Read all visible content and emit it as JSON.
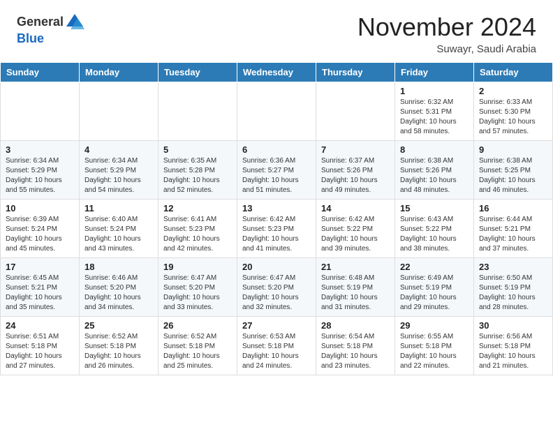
{
  "header": {
    "logo_line1": "General",
    "logo_line2": "Blue",
    "month_year": "November 2024",
    "location": "Suwayr, Saudi Arabia"
  },
  "weekdays": [
    "Sunday",
    "Monday",
    "Tuesday",
    "Wednesday",
    "Thursday",
    "Friday",
    "Saturday"
  ],
  "weeks": [
    [
      {
        "day": "",
        "info": ""
      },
      {
        "day": "",
        "info": ""
      },
      {
        "day": "",
        "info": ""
      },
      {
        "day": "",
        "info": ""
      },
      {
        "day": "",
        "info": ""
      },
      {
        "day": "1",
        "info": "Sunrise: 6:32 AM\nSunset: 5:31 PM\nDaylight: 10 hours\nand 58 minutes."
      },
      {
        "day": "2",
        "info": "Sunrise: 6:33 AM\nSunset: 5:30 PM\nDaylight: 10 hours\nand 57 minutes."
      }
    ],
    [
      {
        "day": "3",
        "info": "Sunrise: 6:34 AM\nSunset: 5:29 PM\nDaylight: 10 hours\nand 55 minutes."
      },
      {
        "day": "4",
        "info": "Sunrise: 6:34 AM\nSunset: 5:29 PM\nDaylight: 10 hours\nand 54 minutes."
      },
      {
        "day": "5",
        "info": "Sunrise: 6:35 AM\nSunset: 5:28 PM\nDaylight: 10 hours\nand 52 minutes."
      },
      {
        "day": "6",
        "info": "Sunrise: 6:36 AM\nSunset: 5:27 PM\nDaylight: 10 hours\nand 51 minutes."
      },
      {
        "day": "7",
        "info": "Sunrise: 6:37 AM\nSunset: 5:26 PM\nDaylight: 10 hours\nand 49 minutes."
      },
      {
        "day": "8",
        "info": "Sunrise: 6:38 AM\nSunset: 5:26 PM\nDaylight: 10 hours\nand 48 minutes."
      },
      {
        "day": "9",
        "info": "Sunrise: 6:38 AM\nSunset: 5:25 PM\nDaylight: 10 hours\nand 46 minutes."
      }
    ],
    [
      {
        "day": "10",
        "info": "Sunrise: 6:39 AM\nSunset: 5:24 PM\nDaylight: 10 hours\nand 45 minutes."
      },
      {
        "day": "11",
        "info": "Sunrise: 6:40 AM\nSunset: 5:24 PM\nDaylight: 10 hours\nand 43 minutes."
      },
      {
        "day": "12",
        "info": "Sunrise: 6:41 AM\nSunset: 5:23 PM\nDaylight: 10 hours\nand 42 minutes."
      },
      {
        "day": "13",
        "info": "Sunrise: 6:42 AM\nSunset: 5:23 PM\nDaylight: 10 hours\nand 41 minutes."
      },
      {
        "day": "14",
        "info": "Sunrise: 6:42 AM\nSunset: 5:22 PM\nDaylight: 10 hours\nand 39 minutes."
      },
      {
        "day": "15",
        "info": "Sunrise: 6:43 AM\nSunset: 5:22 PM\nDaylight: 10 hours\nand 38 minutes."
      },
      {
        "day": "16",
        "info": "Sunrise: 6:44 AM\nSunset: 5:21 PM\nDaylight: 10 hours\nand 37 minutes."
      }
    ],
    [
      {
        "day": "17",
        "info": "Sunrise: 6:45 AM\nSunset: 5:21 PM\nDaylight: 10 hours\nand 35 minutes."
      },
      {
        "day": "18",
        "info": "Sunrise: 6:46 AM\nSunset: 5:20 PM\nDaylight: 10 hours\nand 34 minutes."
      },
      {
        "day": "19",
        "info": "Sunrise: 6:47 AM\nSunset: 5:20 PM\nDaylight: 10 hours\nand 33 minutes."
      },
      {
        "day": "20",
        "info": "Sunrise: 6:47 AM\nSunset: 5:20 PM\nDaylight: 10 hours\nand 32 minutes."
      },
      {
        "day": "21",
        "info": "Sunrise: 6:48 AM\nSunset: 5:19 PM\nDaylight: 10 hours\nand 31 minutes."
      },
      {
        "day": "22",
        "info": "Sunrise: 6:49 AM\nSunset: 5:19 PM\nDaylight: 10 hours\nand 29 minutes."
      },
      {
        "day": "23",
        "info": "Sunrise: 6:50 AM\nSunset: 5:19 PM\nDaylight: 10 hours\nand 28 minutes."
      }
    ],
    [
      {
        "day": "24",
        "info": "Sunrise: 6:51 AM\nSunset: 5:18 PM\nDaylight: 10 hours\nand 27 minutes."
      },
      {
        "day": "25",
        "info": "Sunrise: 6:52 AM\nSunset: 5:18 PM\nDaylight: 10 hours\nand 26 minutes."
      },
      {
        "day": "26",
        "info": "Sunrise: 6:52 AM\nSunset: 5:18 PM\nDaylight: 10 hours\nand 25 minutes."
      },
      {
        "day": "27",
        "info": "Sunrise: 6:53 AM\nSunset: 5:18 PM\nDaylight: 10 hours\nand 24 minutes."
      },
      {
        "day": "28",
        "info": "Sunrise: 6:54 AM\nSunset: 5:18 PM\nDaylight: 10 hours\nand 23 minutes."
      },
      {
        "day": "29",
        "info": "Sunrise: 6:55 AM\nSunset: 5:18 PM\nDaylight: 10 hours\nand 22 minutes."
      },
      {
        "day": "30",
        "info": "Sunrise: 6:56 AM\nSunset: 5:18 PM\nDaylight: 10 hours\nand 21 minutes."
      }
    ]
  ]
}
